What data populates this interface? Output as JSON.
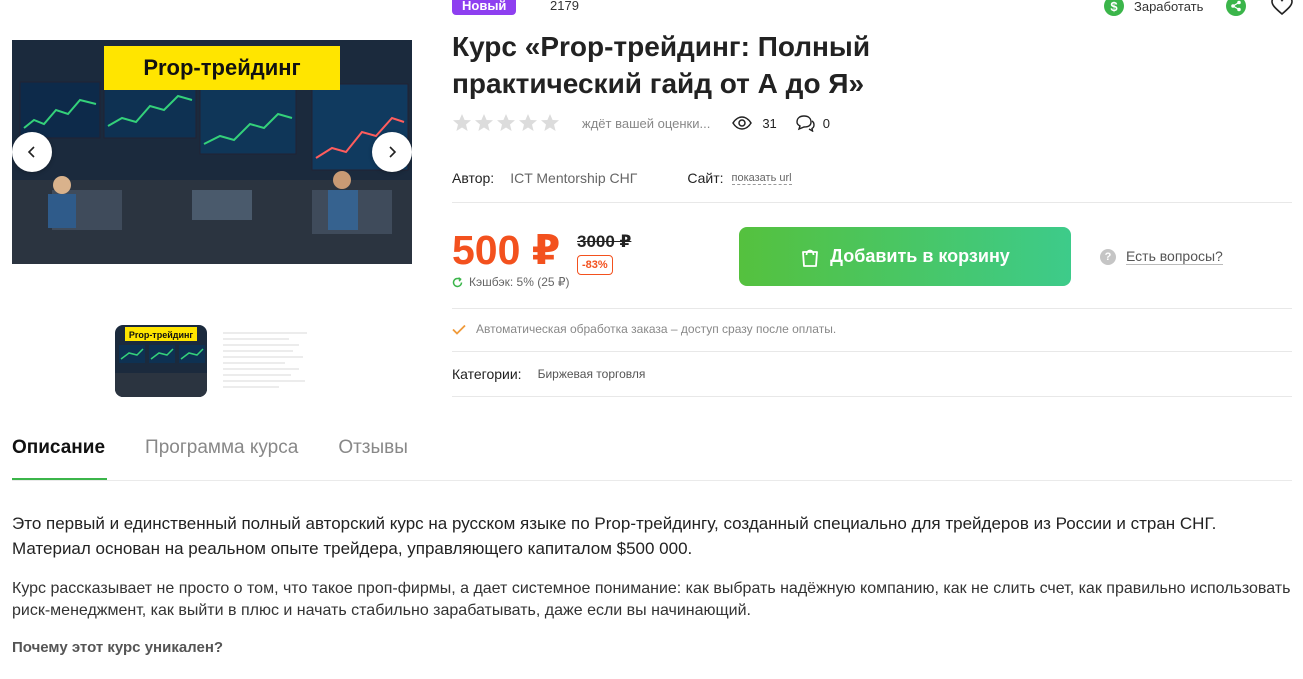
{
  "header": {
    "badge_new": "Новый",
    "product_id": "2179",
    "earn_label": "Заработать",
    "earn_icon": "dollar-icon",
    "share_icon": "share-icon",
    "favorite_icon": "heart-icon"
  },
  "gallery": {
    "main_banner_text": "Prop-трейдинг",
    "thumb_banner_text": "Prop-трейдинг",
    "prev_icon": "chevron-left-icon",
    "next_icon": "chevron-right-icon"
  },
  "product": {
    "title": "Курс «Prop-трейдинг: Полный практический гайд от А до Я»",
    "rating_text": "ждёт вашей оценки...",
    "views": "31",
    "comments": "0",
    "author_label": "Автор:",
    "author": "ICT Mentorship СНГ",
    "site_label": "Сайт:",
    "site_link": "показать url",
    "price": "500 ₽",
    "old_price": "3000 ₽",
    "discount": "-83%",
    "cashback": "Кэшбэк: 5% (25 ₽)",
    "cart_button": "Добавить в корзину",
    "questions": "Есть вопросы?",
    "auto_note": "Автоматическая обработка заказа – доступ сразу после оплаты.",
    "categories_label": "Категории:",
    "category": "Биржевая торговля"
  },
  "tabs": [
    {
      "label": "Описание",
      "active": true
    },
    {
      "label": "Программа курса",
      "active": false
    },
    {
      "label": "Отзывы",
      "active": false
    }
  ],
  "description": {
    "lead": "Это первый и единственный полный авторский курс на русском языке по Prop-трейдингу, созданный специально для трейдеров из России и стран СНГ. Материал основан на реальном опыте трейдера, управляющего капиталом $500 000.",
    "body": "Курс рассказывает не просто о том, что такое проп-фирмы, а дает системное понимание: как выбрать надёжную компанию, как не слить счет, как правильно использовать риск-менеджмент, как выйти в плюс и начать стабильно зарабатывать, даже если вы начинающий.",
    "why": "Почему этот курс уникален?"
  },
  "colors": {
    "accent_green": "#3bb54a",
    "price_orange": "#f3511e",
    "badge_purple": "#8e3ff0",
    "banner_yellow": "#ffe500"
  }
}
